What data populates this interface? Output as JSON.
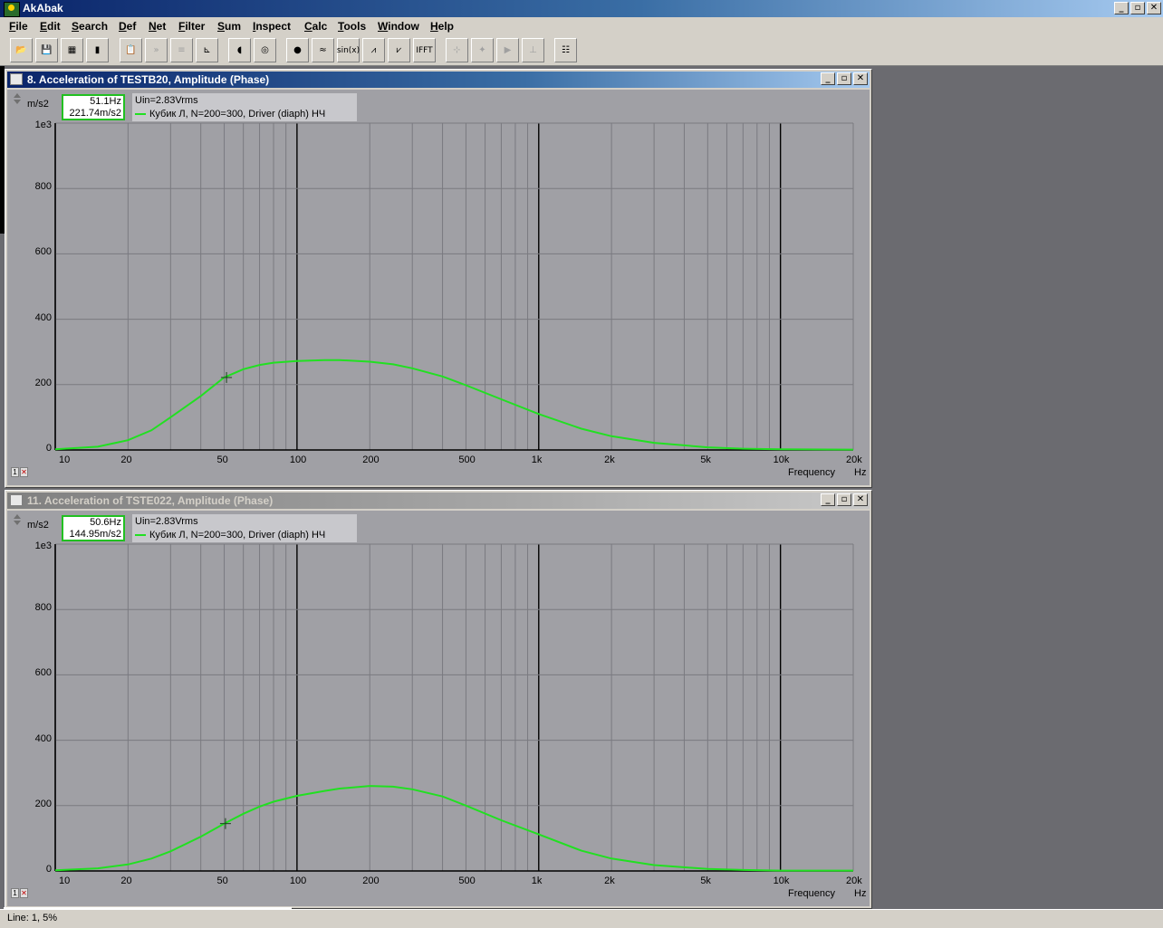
{
  "app": {
    "title": "AkAbak",
    "window_buttons": [
      "_",
      "▫",
      "✕"
    ]
  },
  "menu": [
    {
      "label": "File",
      "u": "F",
      "rest": "ile"
    },
    {
      "label": "Edit",
      "u": "E",
      "rest": "dit"
    },
    {
      "label": "Search",
      "u": "S",
      "rest": "earch"
    },
    {
      "label": "Def",
      "u": "D",
      "rest": "ef"
    },
    {
      "label": "Net",
      "u": "N",
      "rest": "et"
    },
    {
      "label": "Filter",
      "u": "F",
      "rest": "ilter"
    },
    {
      "label": "Sum",
      "u": "S",
      "rest": "um"
    },
    {
      "label": "Inspect",
      "u": "I",
      "rest": "nspect"
    },
    {
      "label": "Calc",
      "u": "C",
      "rest": "alc"
    },
    {
      "label": "Tools",
      "u": "T",
      "rest": "ools"
    },
    {
      "label": "Window",
      "u": "W",
      "rest": "indow"
    },
    {
      "label": "Help",
      "u": "H",
      "rest": "elp"
    }
  ],
  "toolbar": {
    "buttons": [
      {
        "icon": "open-folder-icon",
        "glyph": "📂",
        "enabled": true
      },
      {
        "icon": "save-icon",
        "glyph": "💾",
        "enabled": true
      },
      {
        "icon": "network-icon",
        "glyph": "▦",
        "enabled": true
      },
      {
        "icon": "driver-icon",
        "glyph": "▮",
        "enabled": true
      },
      {
        "icon": "paste-icon",
        "glyph": "📋",
        "enabled": true
      },
      {
        "icon": "step-icon",
        "glyph": "»",
        "enabled": false
      },
      {
        "icon": "sum-icon",
        "glyph": "≡",
        "enabled": false
      },
      {
        "icon": "axes-icon",
        "glyph": "⊾",
        "enabled": true
      },
      {
        "icon": "speaker-icon",
        "glyph": "◖",
        "enabled": true
      },
      {
        "icon": "target-icon",
        "glyph": "◎",
        "enabled": true
      },
      {
        "icon": "record-icon",
        "glyph": "●",
        "enabled": true
      },
      {
        "icon": "signal-icon",
        "glyph": "≈",
        "enabled": true
      },
      {
        "icon": "sine-icon",
        "glyph": "sin(x)",
        "enabled": true
      },
      {
        "icon": "response-up-icon",
        "glyph": "⩘",
        "enabled": true
      },
      {
        "icon": "response-down-icon",
        "glyph": "⩗",
        "enabled": true
      },
      {
        "icon": "ifft-icon",
        "glyph": "IFFT",
        "enabled": true
      },
      {
        "icon": "tool-a-icon",
        "glyph": "⊹",
        "enabled": false
      },
      {
        "icon": "tool-b-icon",
        "glyph": "✦",
        "enabled": false
      },
      {
        "icon": "tool-c-icon",
        "glyph": "▶",
        "enabled": false
      },
      {
        "icon": "tool-d-icon",
        "glyph": "⊥",
        "enabled": false
      },
      {
        "icon": "compare-plots-icon",
        "glyph": "☷",
        "enabled": true
      }
    ]
  },
  "windows": [
    {
      "caption": "8. Acceleration of TESTB20, Amplitude (Phase)",
      "active": true,
      "readout": {
        "freq": "51.1Hz",
        "value": "221.74m/s2"
      },
      "legend": {
        "line1": "Uin=2.83Vrms",
        "series": "Кубик Л, N=200=300, Driver (diaph) НЧ"
      },
      "y_unit": "m/s2",
      "y_exp": "1e3",
      "x_title": "Frequency",
      "x_unit": "Hz",
      "chart_data": {
        "type": "line",
        "xscale": "log",
        "xlim": [
          10,
          20000
        ],
        "ylim": [
          0,
          1000
        ],
        "x_ticks": [
          "10",
          "20",
          "50",
          "100",
          "200",
          "500",
          "1k",
          "2k",
          "5k",
          "10k",
          "20k"
        ],
        "y_ticks": [
          "0",
          "200",
          "400",
          "600",
          "800",
          "1e3"
        ],
        "series": [
          {
            "name": "Кубик Л, N=200=300, Driver (diaph) НЧ",
            "color": "#21e021",
            "x": [
              10,
              15,
              20,
              25,
              30,
              40,
              50,
              60,
              70,
              80,
              100,
              130,
              150,
              200,
              250,
              300,
              400,
              500,
              700,
              1000,
              1500,
              2000,
              3000,
              5000,
              7000,
              10000,
              20000
            ],
            "y": [
              2,
              10,
              30,
              60,
              100,
              165,
              222,
              247,
              260,
              267,
              272,
              275,
              275,
              270,
              262,
              250,
              225,
              198,
              155,
              110,
              65,
              42,
              22,
              8,
              4,
              2,
              1
            ]
          }
        ],
        "cursor": {
          "x": 51.1,
          "y": 221.74
        }
      }
    },
    {
      "caption": "11. Acceleration of TSTE022, Amplitude (Phase)",
      "active": false,
      "readout": {
        "freq": "50.6Hz",
        "value": "144.95m/s2"
      },
      "legend": {
        "line1": "Uin=2.83Vrms",
        "series": "Кубик Л, N=200=300, Driver (diaph) НЧ"
      },
      "y_unit": "m/s2",
      "y_exp": "1e3",
      "x_title": "Frequency",
      "x_unit": "Hz",
      "chart_data": {
        "type": "line",
        "xscale": "log",
        "xlim": [
          10,
          20000
        ],
        "ylim": [
          0,
          1000
        ],
        "x_ticks": [
          "10",
          "20",
          "50",
          "100",
          "200",
          "500",
          "1k",
          "2k",
          "5k",
          "10k",
          "20k"
        ],
        "y_ticks": [
          "0",
          "200",
          "400",
          "600",
          "800",
          "1e3"
        ],
        "series": [
          {
            "name": "Кубик Л, N=200=300, Driver (diaph) НЧ",
            "color": "#21e021",
            "x": [
              10,
              15,
              20,
              25,
              30,
              40,
              50,
              60,
              70,
              80,
              100,
              130,
              150,
              200,
              250,
              300,
              400,
              500,
              700,
              1000,
              1500,
              2000,
              3000,
              5000,
              7000,
              10000,
              20000
            ],
            "y": [
              2,
              8,
              20,
              38,
              60,
              105,
              145,
              175,
              197,
              212,
              230,
              245,
              252,
              260,
              258,
              250,
              228,
              200,
              155,
              112,
              62,
              38,
              18,
              6,
              3,
              1,
              1
            ]
          }
        ],
        "cursor": {
          "x": 50.6,
          "y": 144.95
        }
      }
    }
  ],
  "status": {
    "text": "Line: 1, 5%"
  }
}
